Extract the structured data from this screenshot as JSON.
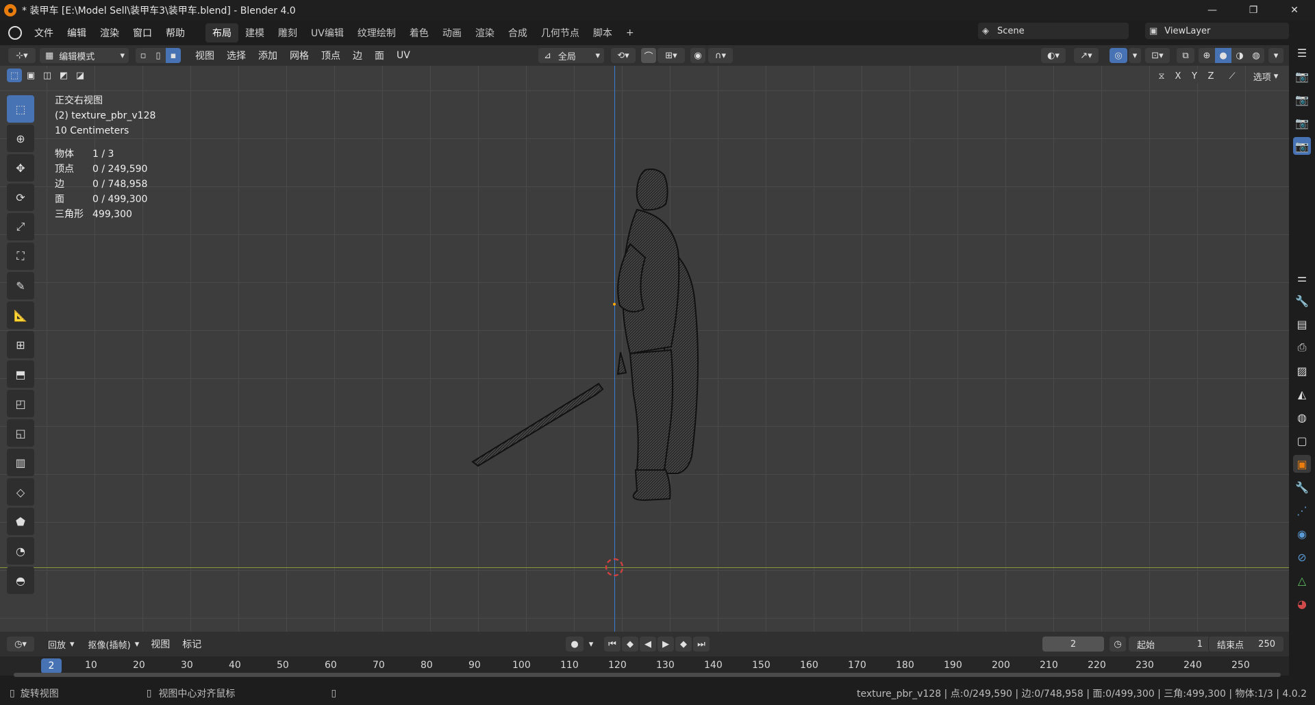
{
  "window": {
    "title": "* 装甲车 [E:\\Model Sell\\装甲车3\\装甲车.blend] - Blender 4.0",
    "minimize": "—",
    "maximize": "❐",
    "close": "✕"
  },
  "menu": [
    "文件",
    "编辑",
    "渲染",
    "窗口",
    "帮助"
  ],
  "workspaces": [
    "布局",
    "建模",
    "雕刻",
    "UV编辑",
    "纹理绘制",
    "着色",
    "动画",
    "渲染",
    "合成",
    "几何节点",
    "脚本",
    "+"
  ],
  "scene": {
    "name": "Scene",
    "view_layer": "ViewLayer"
  },
  "header": {
    "mode": "编辑模式",
    "menus": [
      "视图",
      "选择",
      "添加",
      "网格",
      "顶点",
      "边",
      "面",
      "UV"
    ],
    "transform": "全局",
    "axes": [
      "X",
      "Y",
      "Z"
    ],
    "options": "选项"
  },
  "overlay": {
    "view_name": "正交右视图",
    "object": "(2) texture_pbr_v128",
    "scale": "10 Centimeters"
  },
  "stats": [
    {
      "k": "物体",
      "v": "1 / 3"
    },
    {
      "k": "顶点",
      "v": "0 / 249,590"
    },
    {
      "k": "边",
      "v": "0 / 748,958"
    },
    {
      "k": "面",
      "v": "0 / 499,300"
    },
    {
      "k": "三角形",
      "v": "499,300"
    }
  ],
  "timeline": {
    "playback": "回放",
    "keying": "抠像(插帧)",
    "view": "视图",
    "marker": "标记",
    "current_frame": "2",
    "start_label": "起始",
    "start": "1",
    "end_label": "结束点",
    "end": "250",
    "ticks": [
      "2",
      "10",
      "20",
      "30",
      "40",
      "50",
      "60",
      "70",
      "80",
      "90",
      "100",
      "110",
      "120",
      "130",
      "140",
      "150",
      "160",
      "170",
      "180",
      "190",
      "200",
      "210",
      "220",
      "230",
      "240",
      "250"
    ]
  },
  "status": {
    "left": "旋转视图",
    "mid": "视图中心对齐鼠标",
    "right": "texture_pbr_v128 | 点:0/249,590 | 边:0/748,958 | 面:0/499,300 | 三角:499,300 | 物体:1/3 | 4.0.2"
  },
  "colors": {
    "accent": "#4772b3",
    "blender_orange": "#e87d0d",
    "grid_x": "#8a9a3a",
    "axis_z": "#3a7bd5"
  }
}
